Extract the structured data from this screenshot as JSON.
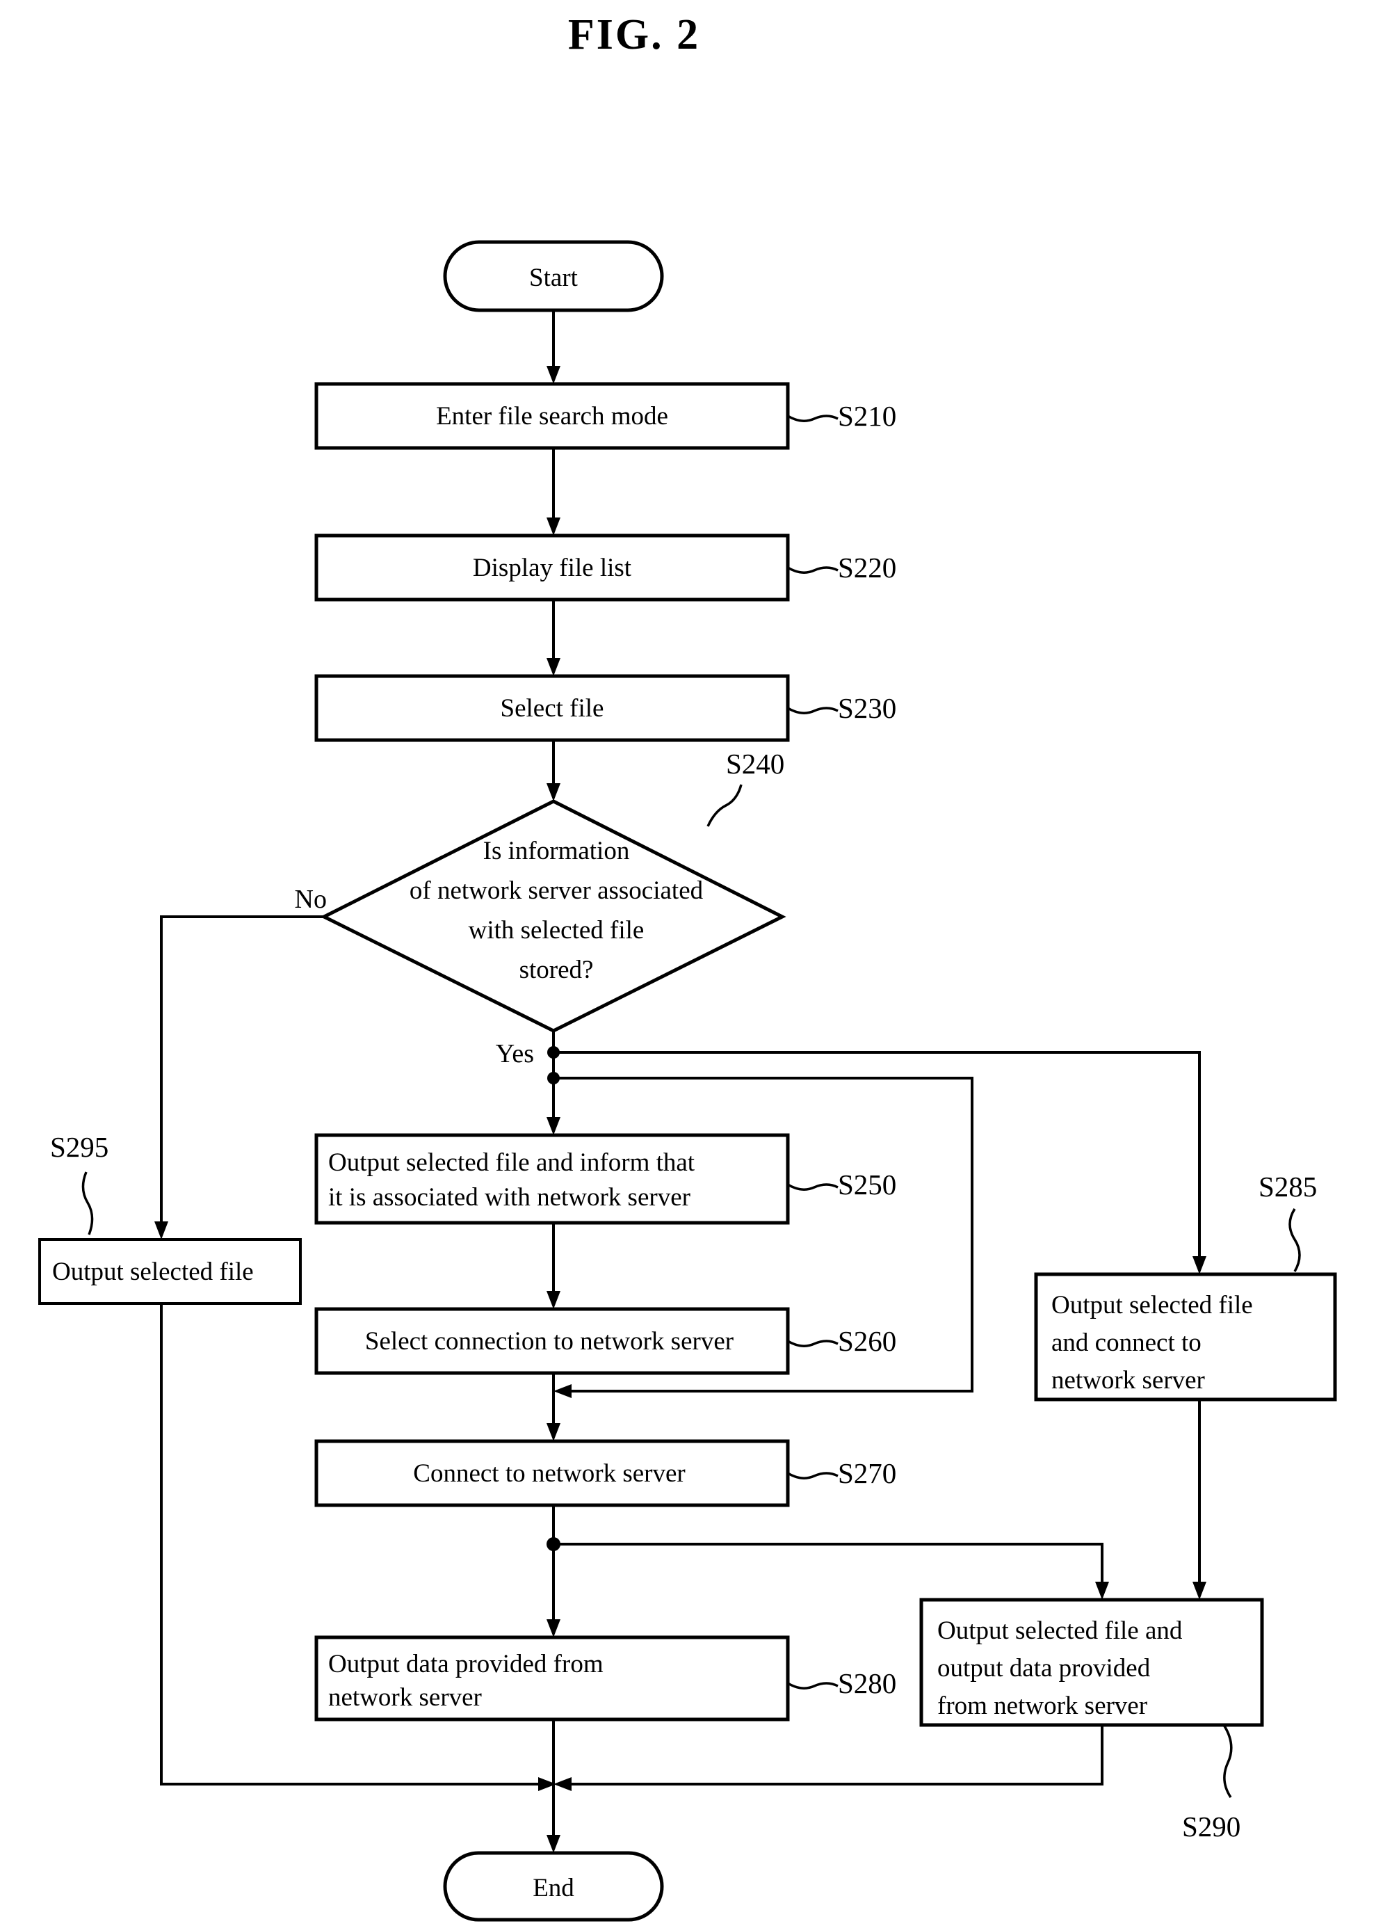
{
  "figure": {
    "title": "FIG. 2",
    "type": "flowchart"
  },
  "nodes": {
    "start": {
      "label": "Start",
      "shape": "terminator"
    },
    "end": {
      "label": "End",
      "shape": "terminator"
    },
    "s210": {
      "label": "Enter file search mode",
      "ref": "S210",
      "shape": "process"
    },
    "s220": {
      "label": "Display file list",
      "ref": "S220",
      "shape": "process"
    },
    "s230": {
      "label": "Select file",
      "ref": "S230",
      "shape": "process"
    },
    "s240": {
      "ref": "S240",
      "shape": "decision",
      "line1": "Is information",
      "line2": "of network server associated",
      "line3": "with selected file",
      "line4": "stored?"
    },
    "s250": {
      "ref": "S250",
      "shape": "process",
      "line1": "Output selected file and inform that",
      "line2": "it is associated with network server"
    },
    "s260": {
      "label": "Select connection to network server",
      "ref": "S260",
      "shape": "process"
    },
    "s270": {
      "label": "Connect to network server",
      "ref": "S270",
      "shape": "process"
    },
    "s280": {
      "ref": "S280",
      "shape": "process",
      "line1": "Output data provided from",
      "line2": "network server"
    },
    "s285": {
      "ref": "S285",
      "shape": "process",
      "line1": "Output selected file",
      "line2": "and connect to",
      "line3": "network server"
    },
    "s290": {
      "ref": "S290",
      "shape": "process",
      "line1": "Output selected file and",
      "line2": "output data provided",
      "line3": "from network server"
    },
    "s295": {
      "label": "Output selected file",
      "ref": "S295",
      "shape": "process"
    }
  },
  "branches": {
    "no": "No",
    "yes": "Yes"
  },
  "colors": {
    "ink": "#000000",
    "paper": "#ffffff"
  }
}
